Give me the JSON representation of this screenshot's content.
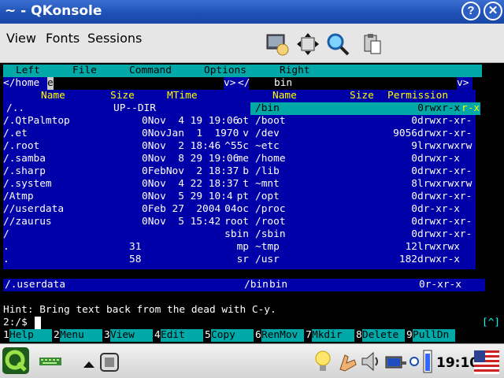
{
  "window": {
    "title": "~ - QKonsole"
  },
  "menubar": {
    "items": [
      "View",
      "Fonts",
      "Sessions"
    ]
  },
  "mc": {
    "menu": [
      "Left",
      "File",
      "Command",
      "Options",
      "Right"
    ],
    "left_path": "</home",
    "left_path_cursor": "e",
    "left_scroll": "v>",
    "right_path": "bin",
    "right_scroll": "v>",
    "columns_left": [
      "Name",
      "Size",
      "MTime"
    ],
    "columns_right": [
      "Name",
      "Size",
      "Permission"
    ],
    "left_rows": [
      [
        "/..",
        "UP--DIR",
        "bin"
      ],
      [
        "/.QtPalmtop",
        "0Nov  4 19 19:06",
        "ot"
      ],
      [
        "/.et",
        "0NovJan  1  1970",
        "v"
      ],
      [
        "/.root",
        "0Nov  2 18:46",
        "^55c"
      ],
      [
        "/.samba",
        "0Nov  8 29 19:06",
        "me"
      ],
      [
        "/.sharp",
        "0FebNov  2 18:37",
        "b"
      ],
      [
        "/.system",
        "0Nov  4 22 18:37",
        "t"
      ],
      [
        "/Atmp",
        "0Nov  5 29 10:4",
        "pt"
      ],
      [
        "//userdata",
        "0Feb 27  2004",
        "04oc"
      ],
      [
        "//zaurus",
        "0Nov  5 15:42",
        "root"
      ],
      [
        "/",
        "",
        "sbin"
      ],
      [
        ".",
        "31",
        "mp"
      ],
      [
        ".",
        "58",
        "sr"
      ]
    ],
    "right_rows": [
      [
        "/bin",
        "0",
        "rwxr-x",
        "r-x"
      ],
      [
        "/boot",
        "0",
        "drwxr-xr-",
        ""
      ],
      [
        "/dev",
        "9056",
        "drwxr-xr-",
        ""
      ],
      [
        "~etc",
        "9",
        "lrwxrwxrw",
        ""
      ],
      [
        "/home",
        "0",
        "drwxr-x",
        ""
      ],
      [
        "/lib",
        "0",
        "drwxr-xr-",
        ""
      ],
      [
        "~mnt",
        "8",
        "lrwxrwxrw",
        ""
      ],
      [
        "/opt",
        "0",
        "drwxr-xr-",
        ""
      ],
      [
        "/proc",
        "0",
        "dr-xr-x",
        ""
      ],
      [
        "/root",
        "0",
        "drwxr-xr-",
        ""
      ],
      [
        "/sbin",
        "0",
        "drwxr-xr-",
        ""
      ],
      [
        "~tmp",
        "12",
        "lrwxrwx",
        ""
      ],
      [
        "/usr",
        "182",
        "drwxr-x",
        ""
      ]
    ],
    "left_status": "/.userdata",
    "right_status_name": "/bin",
    "right_status_extra": "bin",
    "right_status_perm": "0r-xr-x",
    "hint": "Hint: Bring text back from the dead with C-y.",
    "prompt": "2:/$ ",
    "right_indicator": "[^]",
    "fkeys": [
      {
        "num": "1",
        "label": "Help"
      },
      {
        "num": "2",
        "label": "Menu"
      },
      {
        "num": "3",
        "label": "View"
      },
      {
        "num": "4",
        "label": "Edit"
      },
      {
        "num": "5",
        "label": "Copy"
      },
      {
        "num": "6",
        "label": "RenMov"
      },
      {
        "num": "7",
        "label": "Mkdir"
      },
      {
        "num": "8",
        "label": "Delete"
      },
      {
        "num": "9",
        "label": "PullDn"
      }
    ]
  },
  "taskbar": {
    "clock": "19:10"
  },
  "colors": {
    "terminal_blue": "#0000a8",
    "terminal_cyan": "#00a8a8",
    "titlebar": "#1d4fb4"
  }
}
